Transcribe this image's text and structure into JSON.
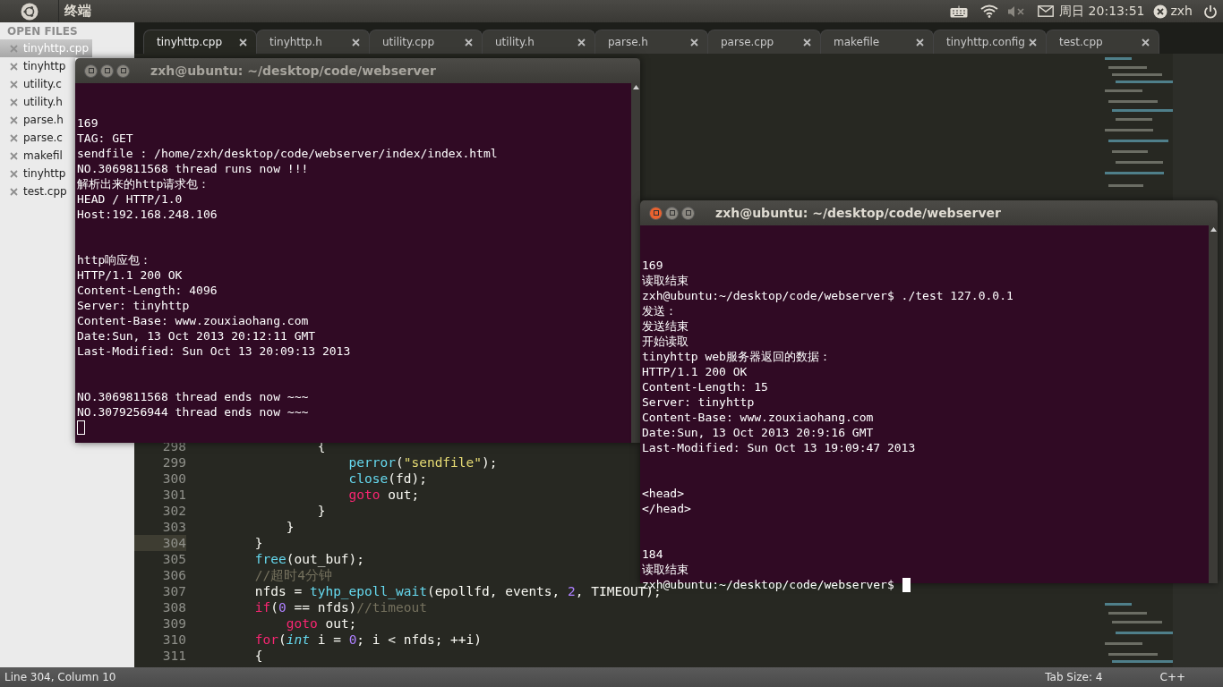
{
  "top_panel": {
    "app_title": "终端",
    "clock": "周日 20:13:51",
    "user": "zxh"
  },
  "sidebar": {
    "heading": "OPEN FILES",
    "files": [
      {
        "name": "tinyhttp.cpp",
        "selected": true
      },
      {
        "name": "tinyhttp",
        "selected": false
      },
      {
        "name": "utility.c",
        "selected": false
      },
      {
        "name": "utility.h",
        "selected": false
      },
      {
        "name": "parse.h",
        "selected": false
      },
      {
        "name": "parse.c",
        "selected": false
      },
      {
        "name": "makefil",
        "selected": false
      },
      {
        "name": "tinyhttp",
        "selected": false
      },
      {
        "name": "test.cpp",
        "selected": false
      }
    ]
  },
  "tabs": [
    {
      "label": "tinyhttp.cpp",
      "selected": true
    },
    {
      "label": "tinyhttp.h",
      "selected": false
    },
    {
      "label": "utility.cpp",
      "selected": false
    },
    {
      "label": "utility.h",
      "selected": false
    },
    {
      "label": "parse.h",
      "selected": false
    },
    {
      "label": "parse.cpp",
      "selected": false
    },
    {
      "label": "makefile",
      "selected": false
    },
    {
      "label": "tinyhttp.config",
      "selected": false
    },
    {
      "label": "test.cpp",
      "selected": false
    }
  ],
  "code_lines": [
    {
      "number": "298",
      "current": false,
      "tokens": [
        {
          "text": "                {",
          "kind": "plain"
        }
      ]
    },
    {
      "number": "299",
      "current": false,
      "tokens": [
        {
          "text": "                    perror",
          "kind": "func"
        },
        {
          "text": "(",
          "kind": "plain"
        },
        {
          "text": "\"sendfile\"",
          "kind": "string"
        },
        {
          "text": ");",
          "kind": "plain"
        }
      ]
    },
    {
      "number": "300",
      "current": false,
      "tokens": [
        {
          "text": "                    close",
          "kind": "func"
        },
        {
          "text": "(fd);",
          "kind": "plain"
        }
      ]
    },
    {
      "number": "301",
      "current": false,
      "tokens": [
        {
          "text": "                    goto",
          "kind": "keyword"
        },
        {
          "text": " out;",
          "kind": "plain"
        }
      ]
    },
    {
      "number": "302",
      "current": false,
      "tokens": [
        {
          "text": "                }",
          "kind": "plain"
        }
      ]
    },
    {
      "number": "303",
      "current": false,
      "tokens": [
        {
          "text": "            }",
          "kind": "plain"
        }
      ]
    },
    {
      "number": "304",
      "current": true,
      "tokens": [
        {
          "text": "        }",
          "kind": "plain"
        }
      ]
    },
    {
      "number": "305",
      "current": false,
      "tokens": [
        {
          "text": "        free",
          "kind": "func"
        },
        {
          "text": "(out_buf);",
          "kind": "plain"
        }
      ]
    },
    {
      "number": "306",
      "current": false,
      "tokens": [
        {
          "text": "        //超时4分钟",
          "kind": "comment"
        }
      ]
    },
    {
      "number": "307",
      "current": false,
      "tokens": [
        {
          "text": "        nfds = ",
          "kind": "plain"
        },
        {
          "text": "tyhp_epoll_wait",
          "kind": "func"
        },
        {
          "text": "(epollfd, events, ",
          "kind": "plain"
        },
        {
          "text": "2",
          "kind": "number"
        },
        {
          "text": ", TIMEOUT);",
          "kind": "plain"
        }
      ]
    },
    {
      "number": "308",
      "current": false,
      "tokens": [
        {
          "text": "        if",
          "kind": "keyword"
        },
        {
          "text": "(",
          "kind": "plain"
        },
        {
          "text": "0",
          "kind": "number"
        },
        {
          "text": " == nfds)",
          "kind": "plain"
        },
        {
          "text": "//timeout",
          "kind": "comment"
        }
      ]
    },
    {
      "number": "309",
      "current": false,
      "tokens": [
        {
          "text": "            goto",
          "kind": "keyword"
        },
        {
          "text": " out;",
          "kind": "plain"
        }
      ]
    },
    {
      "number": "310",
      "current": false,
      "tokens": [
        {
          "text": "        for",
          "kind": "keyword"
        },
        {
          "text": "(",
          "kind": "plain"
        },
        {
          "text": "int",
          "kind": "type"
        },
        {
          "text": " i = ",
          "kind": "plain"
        },
        {
          "text": "0",
          "kind": "number"
        },
        {
          "text": "; i < nfds; ++i)",
          "kind": "plain"
        }
      ]
    },
    {
      "number": "311",
      "current": false,
      "tokens": [
        {
          "text": "        {",
          "kind": "plain"
        }
      ]
    }
  ],
  "status_bar": {
    "position": "Line 304, Column 10",
    "tab_size": "Tab Size: 4",
    "syntax": "C++"
  },
  "terminals": [
    {
      "title": "zxh@ubuntu: ~/desktop/code/webserver",
      "active": false,
      "blocks": [
        [
          "169",
          "TAG: GET",
          "sendfile : /home/zxh/desktop/code/webserver/index/index.html",
          "NO.3069811568 thread runs now !!!",
          "解析出来的http请求包：",
          "HEAD / HTTP/1.0",
          "Host:192.168.248.106"
        ],
        [
          "http响应包：",
          "HTTP/1.1 200 OK",
          "Content-Length: 4096",
          "Server: tinyhttp",
          "Content-Base: www.zouxiaohang.com",
          "Date:Sun, 13 Oct 2013 20:12:11 GMT",
          "Last-Modified: Sun Oct 13 20:09:13 2013"
        ],
        [
          "NO.3069811568 thread ends now ~~~",
          "NO.3079256944 thread ends now ~~~"
        ]
      ]
    },
    {
      "title": "zxh@ubuntu: ~/desktop/code/webserver",
      "active": true,
      "blocks": [
        [
          "169",
          "读取结束",
          "zxh@ubuntu:~/desktop/code/webserver$ ./test 127.0.0.1",
          "发送：",
          "发送结束",
          "开始读取",
          "tinyhttp web服务器返回的数据：",
          "HTTP/1.1 200 OK",
          "Content-Length: 15",
          "Server: tinyhttp",
          "Content-Base: www.zouxiaohang.com",
          "Date:Sun, 13 Oct 2013 20:9:16 GMT",
          "Last-Modified: Sun Oct 13 19:09:47 2013"
        ],
        [
          "<head>",
          "</head>"
        ],
        [
          "184",
          "读取结束"
        ]
      ],
      "prompt": "zxh@ubuntu:~/desktop/code/webserver$"
    }
  ]
}
